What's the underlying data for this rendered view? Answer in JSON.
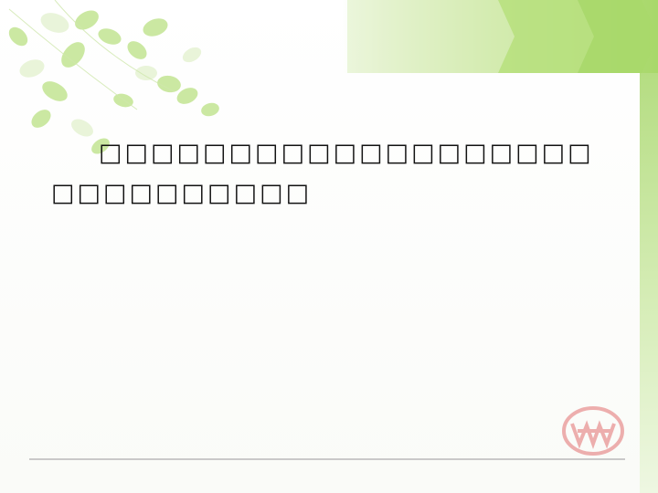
{
  "slide": {
    "body_text": "□□□□□□□□□□□□□□□□□□□□□□□□□□□□□",
    "colors": {
      "accent_green": "#a8d86a",
      "light_green": "#c9e79b",
      "logo_red": "#e27070",
      "text": "#111111"
    },
    "icons": [
      "leaves-decoration",
      "emblem-logo"
    ]
  }
}
